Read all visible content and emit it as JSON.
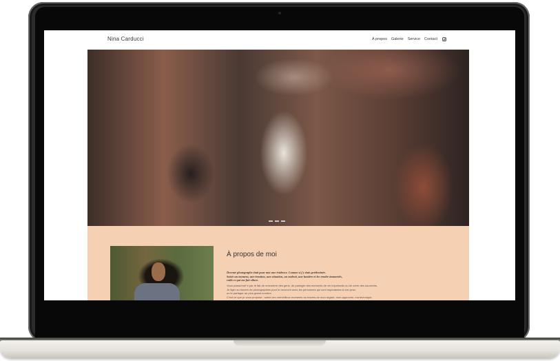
{
  "site": {
    "brand": "Nina Carducci",
    "nav": [
      "À propos",
      "Galerie",
      "Service",
      "Contact"
    ],
    "nav_icon": "instagram-icon"
  },
  "hero": {
    "image_alt": "concert-crowd-photo",
    "slides": 3
  },
  "about": {
    "title": "À propos de moi",
    "quote": [
      "Devenir photographe était pour moi une évidence. Comme si j'y étais prédestinée.",
      "Saisir un moment, une émotion, une situation, un endroit, une lumière et les rendre immortels,",
      "voilà ce qui me fait vibrer."
    ],
    "body": [
      "Vous passionné·e par le fait de rencontrer des gens, de partager des moments de vie importants ou de créer des souvenirs.",
      "Je figer au travers de photographies pour le recouvrir avec les personnes qui sont importantes à vos yeux.",
      "ou le partager au plus grand nombre.",
      "C'est ce que je vous propose : saisir ces merveilleux moments au travers de mon regard, mon approche, ma technique."
    ],
    "portrait_alt": "portrait-photo"
  },
  "colors": {
    "about_background": "#f6d0b3",
    "laptop_frame": "#2b2b2d",
    "laptop_base": "#e6e3dc"
  }
}
